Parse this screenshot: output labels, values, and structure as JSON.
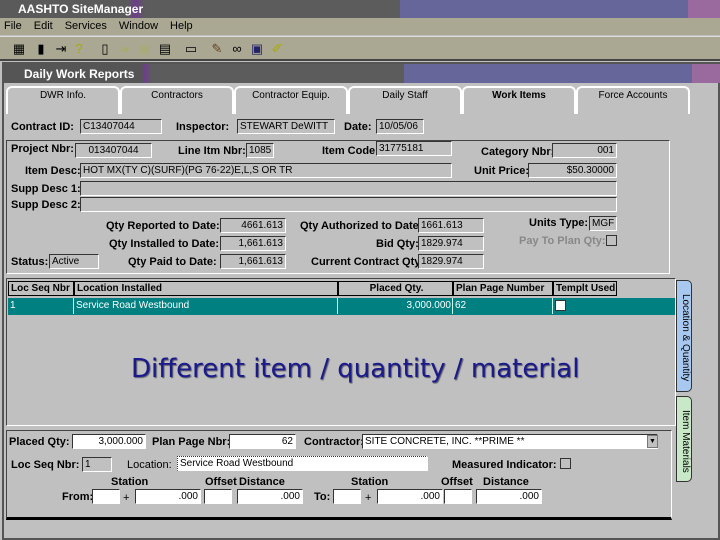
{
  "app": {
    "title": "AASHTO SiteManager",
    "menu": [
      "File",
      "Edit",
      "Services",
      "Window",
      "Help"
    ]
  },
  "toolbar": {
    "icons": [
      "calendar-icon",
      "tool-icon",
      "exit-icon",
      "help-icon",
      "new-icon",
      "open-icon",
      "delete-icon",
      "save-icon",
      "comment-icon",
      "edit-icon",
      "link-icon",
      "window-icon",
      "pencil-icon"
    ]
  },
  "window": {
    "title": "Daily Work Reports"
  },
  "tabs": [
    "DWR Info.",
    "Contractors",
    "Contractor Equip.",
    "Daily Staff",
    "Work Items",
    "Force Accounts"
  ],
  "header": {
    "contract_id_label": "Contract ID:",
    "contract_id": "C13407044",
    "inspector_label": "Inspector:",
    "inspector": "STEWART DeWITT",
    "date_label": "Date:",
    "date": "10/05/06"
  },
  "item": {
    "project_label": "Project Nbr:",
    "project": "013407044",
    "line_label": "Line Itm Nbr:",
    "line": "1085",
    "code_label": "Item Code:",
    "code": "31775181",
    "category_label": "Category Nbr:",
    "category": "001",
    "desc_label": "Item Desc:",
    "desc": "HOT MX(TY C)(SURF)(PG 76-22)E,L,S OR TR",
    "price_label": "Unit Price:",
    "price": "$50.30000",
    "supp1_label": "Supp Desc 1:",
    "supp1": "",
    "supp2_label": "Supp Desc 2:",
    "supp2": "",
    "reported_label": "Qty Reported to Date:",
    "reported": "4661.613",
    "installed_label": "Qty Installed to Date:",
    "installed": "1,661.613",
    "paid_label": "Qty Paid to Date:",
    "paid": "1,661.613",
    "authorized_label": "Qty Authorized to Date:",
    "authorized": "1661.613",
    "bid_label": "Bid Qty:",
    "bid": "1829.974",
    "current_label": "Current Contract Qty:",
    "current": "1829.974",
    "units_label": "Units Type:",
    "units": "MGF",
    "pay_plan_label": "Pay To Plan Qty:",
    "status_label": "Status:",
    "status": "Active"
  },
  "grid": {
    "headers": [
      "Loc Seq Nbr",
      "Location Installed",
      "Placed Qty.",
      "Plan Page Number",
      "Templt Used"
    ],
    "rows": [
      {
        "seq": "1",
        "location": "Service Road Westbound",
        "qty": "3,000.000",
        "page": "62"
      }
    ]
  },
  "side_tabs": [
    "Location & Quantity",
    "Item Materials"
  ],
  "overlay": "Different item / quantity / material",
  "detail": {
    "placed_label": "Placed Qty:",
    "placed": "3,000.000",
    "page_label": "Plan Page Nbr:",
    "page": "62",
    "contractor_label": "Contractor:",
    "contractor": "SITE CONCRETE, INC. **PRIME **",
    "seq_label": "Loc Seq Nbr:",
    "seq": "1",
    "location_label": "Location:",
    "location": "Service Road Westbound",
    "measured_label": "Measured Indicator:",
    "station_label": "Station",
    "offset_label": "Offset",
    "distance_label": "Distance",
    "from_label": "From:",
    "to_label": "To:",
    "plus": "+",
    "from_station": ".000",
    "from_distance": ".000",
    "to_station": ".000",
    "to_distance": ".000"
  },
  "colors": {
    "selection": "#008080",
    "overlay": "#1a1a8c"
  }
}
